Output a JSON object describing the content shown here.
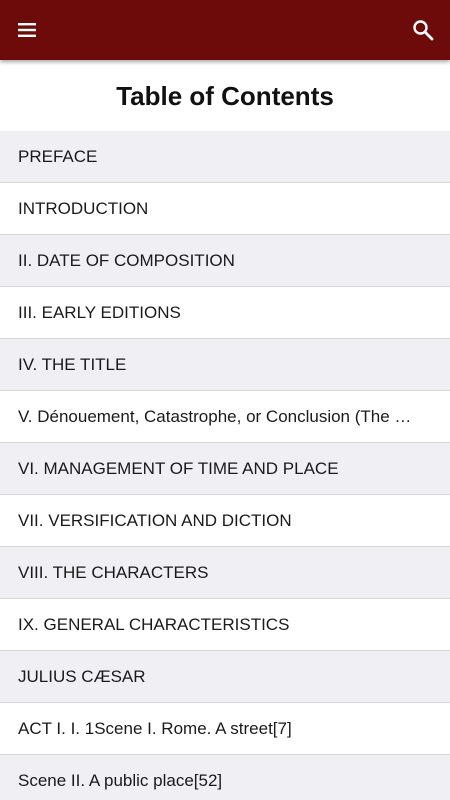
{
  "colors": {
    "toolbar_bg": "#6d0b0b",
    "row_alt_bg": "#efeff4",
    "row_bg": "#ffffff"
  },
  "toolbar": {
    "menu_icon": "hamburger-menu-icon",
    "search_icon": "search-icon"
  },
  "header": {
    "title": "Table of Contents"
  },
  "toc": {
    "items": [
      {
        "label": "PREFACE"
      },
      {
        "label": "INTRODUCTION"
      },
      {
        "label": "II. DATE OF COMPOSITION"
      },
      {
        "label": "III. EARLY EDITIONS"
      },
      {
        "label": "IV. THE TITLE"
      },
      {
        "label": "V. Dénouement, Catastrophe, or Conclusion (The …"
      },
      {
        "label": "VI. MANAGEMENT OF TIME AND PLACE"
      },
      {
        "label": "VII. VERSIFICATION AND DICTION"
      },
      {
        "label": "VIII. THE CHARACTERS"
      },
      {
        "label": "IX. GENERAL CHARACTERISTICS"
      },
      {
        "label": "JULIUS CÆSAR"
      },
      {
        "label": "ACT I. I. 1Scene I. Rome. A street[7]"
      },
      {
        "label": "Scene II. A public place[52]"
      }
    ]
  }
}
